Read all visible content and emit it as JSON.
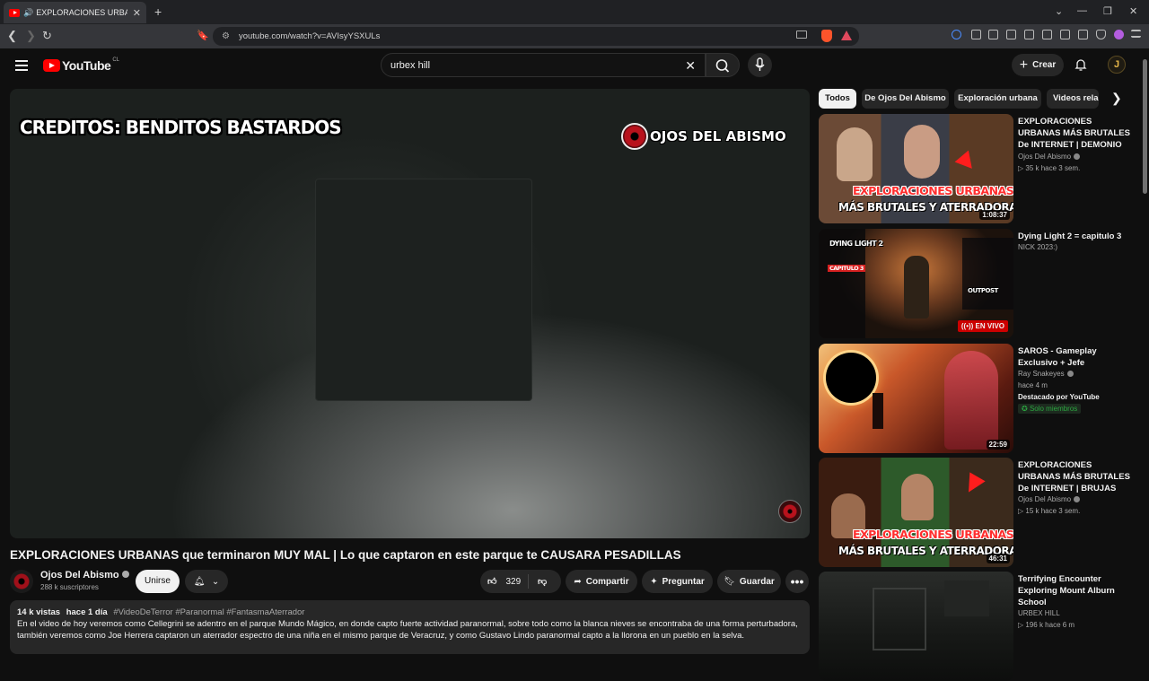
{
  "browser": {
    "tab_title": "EXPLORACIONES URBANAS q",
    "url": "youtube.com/watch?v=AVIsyYSXULs"
  },
  "header": {
    "logo_text": "YouTube",
    "region": "CL",
    "search_value": "urbex hill",
    "create_label": "Crear",
    "avatar_letter": "J"
  },
  "player": {
    "overlay_credit": "CREDITOS: BENDITOS BASTARDOS",
    "overlay_channel": "OJOS DEL ABISMO"
  },
  "video": {
    "title": "EXPLORACIONES URBANAS que terminaron MUY MAL | Lo que captaron en este parque te CAUSARA PESADILLAS",
    "channel": "Ojos Del Abismo",
    "subscribers": "288 k suscriptores",
    "join_label": "Unirse",
    "likes": "329",
    "share_label": "Compartir",
    "ask_label": "Preguntar",
    "save_label": "Guardar",
    "views": "14 k vistas",
    "age": "hace 1 día",
    "tags": "#VideoDeTerror #Paranormal #FantasmaAterrador",
    "description_1": "En el video de hoy veremos como Cellegrini se adentro en el parque Mundo Mágico, en donde capto fuerte actividad paranormal, sobre todo como la blanca nieves se encontraba de una forma perturbadora,",
    "description_2": "también veremos como Joe Herrera captaron un aterrador espectro de una niña en el mismo parque de Veracruz, y como Gustavo Lindo paranormal capto a la llorona en un pueblo en la selva."
  },
  "chips": [
    "Todos",
    "De Ojos Del Abismo",
    "Exploración urbana",
    "Videos relac"
  ],
  "recommendations": [
    {
      "title": "EXPLORACIONES URBANAS MÁS BRUTALES De INTERNET | DEMONIO ATAC...",
      "channel": "Ojos Del Abismo",
      "stats": "▷ 35 k  hace 3 sem.",
      "duration": "1:08:37",
      "thumb_line1": "EXPLORACIONES URBANAS",
      "thumb_line2": "MÁS BRUTALES Y ATERRADORAS"
    },
    {
      "title": "Dying Light 2 = capitulo 3",
      "channel": "NICK 2023:)",
      "live": "EN VIVO",
      "thumb_line1": "DYING LIGHT 2",
      "thumb_line2": "CAPITULO 3",
      "thumb_line3": "OUTPOST"
    },
    {
      "title": "SAROS - Gameplay Exclusivo + Jefe",
      "channel": "Ray Snakeyes",
      "stats": "hace 4 m",
      "extra": "Destacado por YouTube",
      "badge": "Solo miembros",
      "duration": "22:59"
    },
    {
      "title": "EXPLORACIONES URBANAS MÁS BRUTALES De INTERNET | BRUJAS REALE...",
      "channel": "Ojos Del Abismo",
      "stats": "▷ 15 k  hace 3 sem.",
      "duration": "46:31",
      "thumb_line1": "EXPLORACIONES URBANAS",
      "thumb_line2": "MÁS BRUTALES Y ATERRADORAS"
    },
    {
      "title": "Terrifying Encounter Exploring Mount Alburn School",
      "channel": "URBEX HILL",
      "stats": "▷ 196 k  hace 6 m"
    }
  ]
}
